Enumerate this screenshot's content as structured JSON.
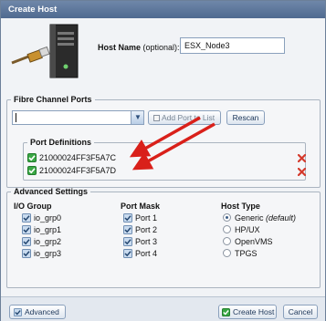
{
  "window": {
    "title": "Create Host"
  },
  "host": {
    "name_label": "Host Name",
    "name_hint": "(optional):",
    "name_value": "ESX_Node3"
  },
  "fibre_channel": {
    "legend": "Fibre Channel Ports",
    "port_input_value": "",
    "add_port_label": "Add Port to List",
    "rescan_label": "Rescan",
    "port_definitions": {
      "legend": "Port Definitions",
      "ports": [
        "21000024FF3F5A7C",
        "21000024FF3F5A7D"
      ]
    }
  },
  "advanced_settings": {
    "legend": "Advanced Settings",
    "io_group": {
      "header": "I/O Group",
      "items": [
        "io_grp0",
        "io_grp1",
        "io_grp2",
        "io_grp3"
      ]
    },
    "port_mask": {
      "header": "Port Mask",
      "items": [
        "Port 1",
        "Port 2",
        "Port 3",
        "Port 4"
      ]
    },
    "host_type": {
      "header": "Host Type",
      "items": [
        "Generic",
        "HP/UX",
        "OpenVMS",
        "TPGS"
      ],
      "generic_suffix": "(default)",
      "selected": "Generic"
    }
  },
  "footer": {
    "advanced_label": "Advanced",
    "create_label": "Create Host",
    "cancel_label": "Cancel"
  },
  "colors": {
    "title_bar": "#5a7499",
    "check_green": "#2f9e3a",
    "delete_red": "#d43a2c",
    "arrow_red": "#d9201a"
  }
}
